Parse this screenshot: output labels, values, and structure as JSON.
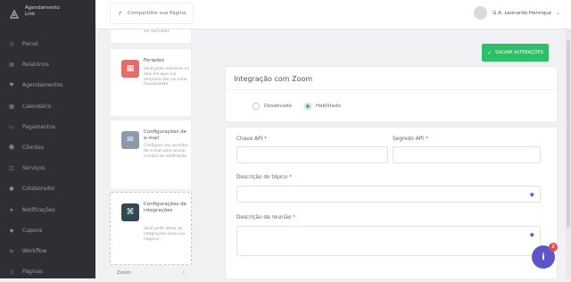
{
  "brand": {
    "line1": "Agendamento",
    "line2": "Link"
  },
  "sidebar": {
    "items": [
      {
        "label": "Painel",
        "icon": "gauge-icon"
      },
      {
        "label": "Relatórios",
        "icon": "chart-icon"
      },
      {
        "label": "Agendamentos",
        "icon": "heart-icon"
      },
      {
        "label": "Calendário",
        "icon": "calendar-icon"
      },
      {
        "label": "Pagamentos",
        "icon": "card-icon"
      },
      {
        "label": "Clientes",
        "icon": "users-icon"
      },
      {
        "label": "Serviços",
        "icon": "layers-icon"
      },
      {
        "label": "Colaborador",
        "icon": "user-icon"
      },
      {
        "label": "Notificações",
        "icon": "send-icon"
      },
      {
        "label": "Cupons",
        "icon": "tag-icon"
      },
      {
        "label": "Workflow",
        "icon": "flow-icon"
      },
      {
        "label": "Páginas",
        "icon": "page-icon"
      }
    ]
  },
  "topbar": {
    "share_label": "Compartilhe sua Página",
    "user_name": "G.A. Leonardo Henrique"
  },
  "cards": [
    {
      "title": "",
      "desc": "ser excluídos",
      "color": "#ffffff"
    },
    {
      "title": "Feriados",
      "desc": "Você pode adicionar os dias em que sua empresa não vai estar funcionando",
      "color": "#e86a6a"
    },
    {
      "title": "Configurações de e-mail",
      "desc": "Configure seu servidor de e-mail para enviar e-mails de notificação",
      "color": "#8a9aaa"
    },
    {
      "title": "Configurações de integrações",
      "desc": "Você pode ativar as integrações para seu negócio",
      "color": "#2f4a52"
    }
  ],
  "zoom_item": {
    "label": "Zoom",
    "caret": "›"
  },
  "main": {
    "save_label": "SALVAR ALTERAÇÕES",
    "panel_title": "Integração com Zoom",
    "radio_off": "Desativado",
    "radio_on": "Habilitado",
    "fields": {
      "api_key": "Chave API",
      "api_secret": "Segredo API",
      "topic": "Descrição do tópico",
      "meeting": "Descrição da reunião",
      "required": "*"
    }
  },
  "fab": {
    "symbol": "i",
    "badge": "2"
  },
  "colors": {
    "accent_green": "#2fbf68",
    "fab_purple": "#5b55c9",
    "sidebar_bg": "#2f2f33"
  }
}
